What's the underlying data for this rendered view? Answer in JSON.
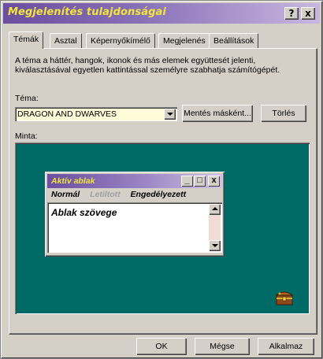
{
  "window": {
    "title": "Megjelenítés tulajdonságai",
    "help_btn": "?",
    "close_btn": "x"
  },
  "tabs": [
    "Témák",
    "Asztal",
    "Képernyőkímélő",
    "Megjelenés",
    "Beállítások"
  ],
  "active_tab": 0,
  "description": "A téma a háttér, hangok, ikonok és más elemek együttesét jelenti, kiválasztásával egyetlen kattintással személyre szabhatja számítógépét.",
  "theme": {
    "label": "Téma:",
    "selected": "DRAGON AND DWARVES",
    "save_as_button": "Mentés másként...",
    "delete_button": "Törlés"
  },
  "preview": {
    "label": "Minta:",
    "mini_window": {
      "title": "Aktív ablak",
      "menu": {
        "normal": "Normál",
        "disabled": "Letiltott",
        "enabled": "Engedélyezett"
      },
      "text": "Ablak szövege",
      "min_btn": "_",
      "max_btn": "□",
      "close_btn": "x"
    }
  },
  "footer": {
    "ok": "OK",
    "cancel": "Mégse",
    "apply": "Alkalmaz"
  },
  "colors": {
    "desktop": "#006b66",
    "title_gradient_start": "#6b4ea0",
    "title_text": "#f2e63a",
    "combo_bg": "#fffbd8"
  }
}
